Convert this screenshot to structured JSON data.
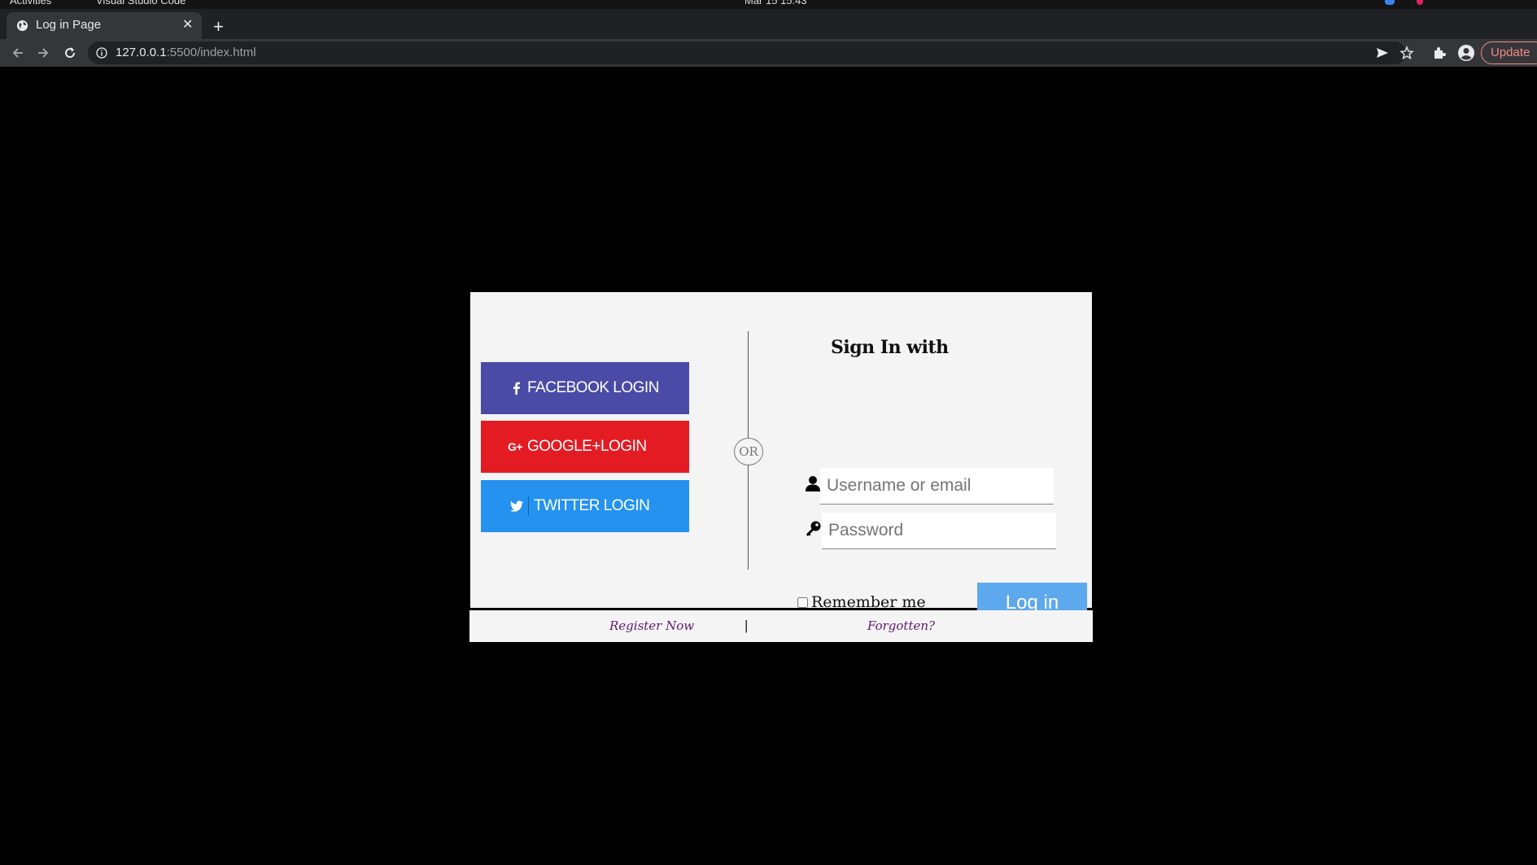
{
  "os": {
    "activities": "Activities",
    "app_name": "Visual Studio Code",
    "clock": "Mar 15 15:43"
  },
  "browser": {
    "tab_title": "Log in Page",
    "tab_close": "✕",
    "new_tab": "+",
    "url_host": "127.0.0.1",
    "url_rest": ":5500/index.html",
    "update_label": "Update"
  },
  "login": {
    "social": {
      "facebook_label": "FACEBOOK LOGIN",
      "google_label": "GOOGLE+LOGIN",
      "twitter_label": "TWITTER LOGIN"
    },
    "or_label": "OR",
    "title": "Sign In with",
    "username_placeholder": "Username or email",
    "password_placeholder": "Password",
    "remember_label": "Remember me",
    "login_label": "Log in"
  },
  "footer": {
    "register_label": "Register Now",
    "separator": "|",
    "forgot_label": "Forgotten?"
  },
  "colors": {
    "facebook": "#4a4ba6",
    "google": "#e31b23",
    "twitter": "#2592f0",
    "login_button": "#5ea8ee",
    "footer_link": "#5b1a74"
  }
}
